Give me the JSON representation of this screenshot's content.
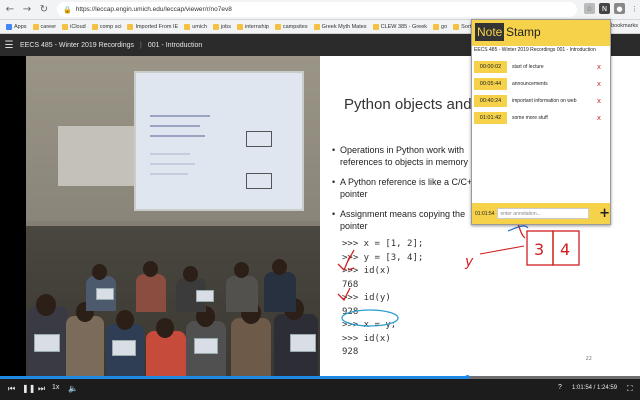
{
  "browser": {
    "url": "https://leccap.engin.umich.edu/leccap/viewer/r/no7ev8",
    "bookmarks": [
      "Apps",
      "career",
      "iCloud",
      "comp sci",
      "Imported From IE",
      "umich",
      "jobs",
      "internship",
      "campsites",
      "Greek Myth Mates",
      "CLEW 385 - Greek",
      "go",
      "Sort Beachcomb"
    ],
    "other_bookmarks": "Other bookmarks"
  },
  "header": {
    "course": "EECS 485 - Winter 2019 Recordings",
    "recording": "001 - Introduction"
  },
  "slide": {
    "title": "Python objects and refere",
    "bullets": [
      "Operations in Python work with references to objects in memory",
      "A Python reference is like a C/C++ pointer",
      "Assignment means copying the pointer"
    ],
    "code": [
      ">>> x = [1, 2];",
      ">>> y = [3, 4];",
      ">>> id(x)",
      "768",
      ">>> id(y)",
      "928",
      ">>> x = y;",
      ">>> id(x)",
      "928"
    ],
    "page_number": "22"
  },
  "notestamp": {
    "logo_note": "Note",
    "logo_stamp": "Stamp",
    "subtitle": "EECS 485 - Winter 2019 Recordings 001 - Introduction",
    "notes": [
      {
        "time": "00:00:02",
        "text": "start of lecture"
      },
      {
        "time": "00:05:44",
        "text": "announcements"
      },
      {
        "time": "00:40:24",
        "text": "important information on web"
      },
      {
        "time": "01:01:42",
        "text": "some more stuff"
      }
    ],
    "delete_symbol": "x",
    "current_time": "01:01:54",
    "input_placeholder": "enter annotation...",
    "add_symbol": "+"
  },
  "player": {
    "progress_fraction": 0.73,
    "time_display": "1:01:54 / 1:24:59",
    "speed": "1x",
    "help": "?"
  },
  "colors": {
    "notestamp_yellow": "#f6d24a",
    "progress_blue": "#1e88e5"
  }
}
